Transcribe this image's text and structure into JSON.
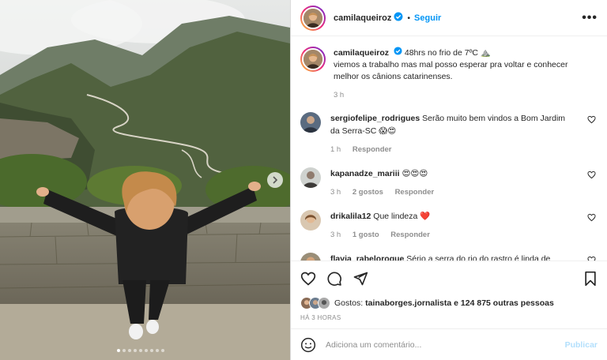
{
  "post": {
    "username": "camilaqueiroz",
    "follow_label": "Seguir",
    "separator": "•",
    "more_label": "•••"
  },
  "caption": {
    "username": "camilaqueiroz",
    "text_line1": "48hrs no frio de 7ºC ⛰️",
    "text_line2": "viemos a trabalho mas mal posso esperar pra voltar e conhecer",
    "text_line3": "melhor os cânions catarinenses.",
    "time": "3 h"
  },
  "comments": [
    {
      "username": "sergiofelipe_rodrigues",
      "text": "Serão muito bem vindos a Bom Jardim",
      "text2": "da Serra-SC 😱😍",
      "time": "1 h",
      "likes": "",
      "reply": "Responder"
    },
    {
      "username": "kapanadze_mariii",
      "text": "😍😍😍",
      "text2": "",
      "time": "3 h",
      "likes": "2 gostos",
      "reply": "Responder"
    },
    {
      "username": "drikalila12",
      "text": "Que lindeza ❤️",
      "text2": "",
      "time": "3 h",
      "likes": "1 gosto",
      "reply": "Responder"
    },
    {
      "username": "flavia_rabeloroque",
      "text": "Sério a serra do rio do rastro é linda de",
      "text2": "",
      "time": "",
      "likes": "",
      "reply": ""
    }
  ],
  "likes": {
    "prefix": "Gostos:",
    "user": "tainaborges.jornalista",
    "suffix": "e 124 875 outras pessoas"
  },
  "posted_time": "HÁ 3 HORAS",
  "add_comment": {
    "placeholder": "Adiciona um comentário...",
    "post_label": "Publicar"
  },
  "carousel": {
    "total_dots": 9,
    "active_index": 0
  },
  "colors": {
    "link": "#0095f6",
    "muted": "#8e8e8e",
    "heart": "#ed4956"
  }
}
